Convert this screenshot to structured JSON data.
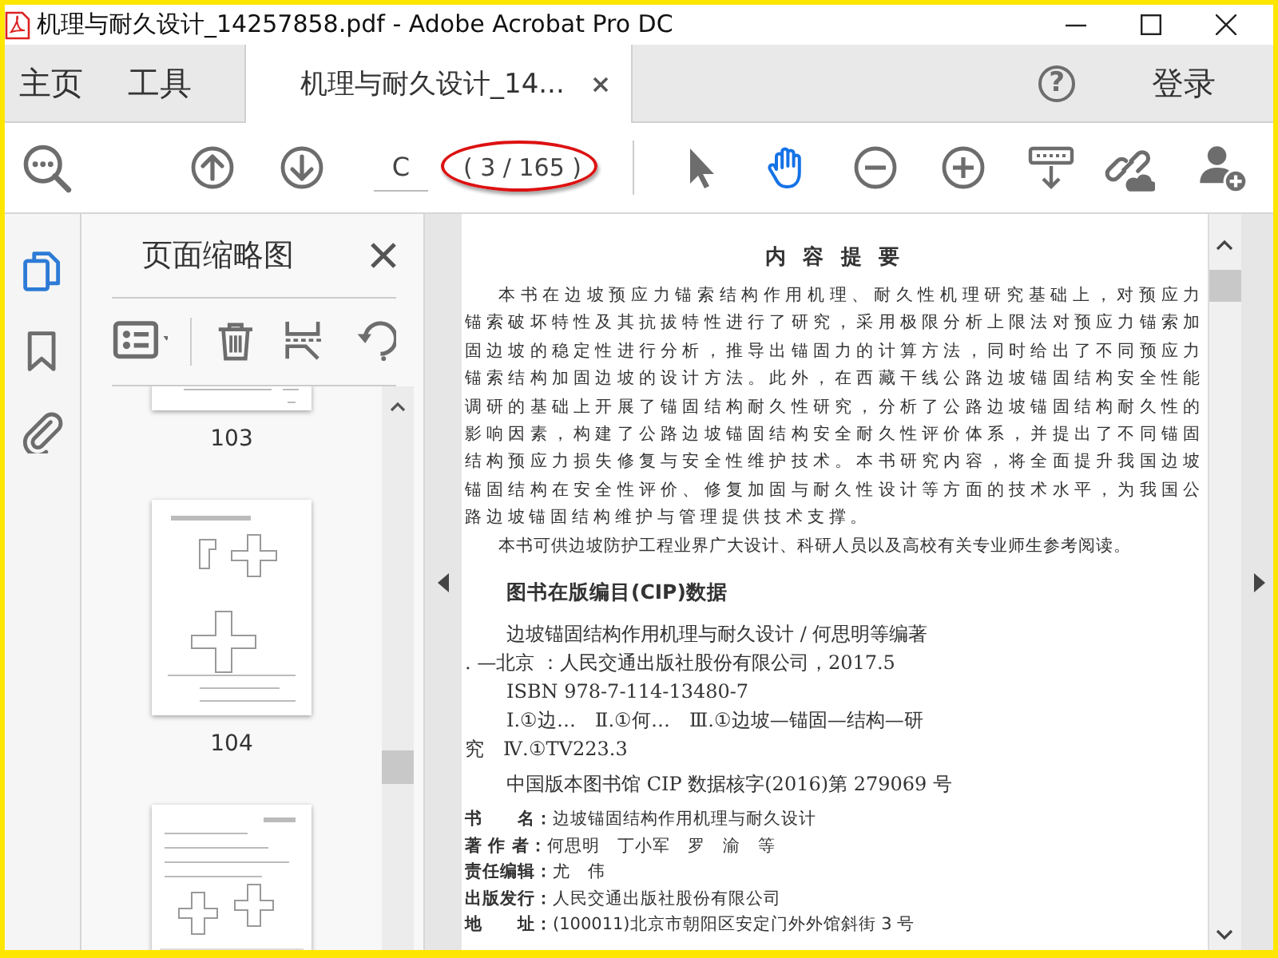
{
  "window": {
    "title": "机理与耐久设计_14257858.pdf - Adobe Acrobat Pro DC"
  },
  "tabs": [
    {
      "label": "主页",
      "selected": false,
      "closable": false
    },
    {
      "label": "工具",
      "selected": false,
      "closable": false
    },
    {
      "label": "机理与耐久设计_14...",
      "selected": true,
      "closable": true
    }
  ],
  "help": {
    "label": "?"
  },
  "sign_in": {
    "label": "登录"
  },
  "toolbar": {
    "search_tool": {
      "kind": "find"
    },
    "nav_tools": [
      {
        "kind": "previous-page"
      },
      {
        "kind": "next-page"
      }
    ],
    "page_input": {
      "value": "C"
    },
    "page_count": {
      "label": "( 3 / 165 )",
      "circled": true
    },
    "view_tools": [
      {
        "kind": "pointer",
        "selected": false
      },
      {
        "kind": "hand",
        "selected": true
      },
      {
        "kind": "zoom-out",
        "selected": false
      },
      {
        "kind": "zoom-in",
        "selected": false
      },
      {
        "kind": "scroll-mode",
        "selected": false
      }
    ],
    "share_tools": [
      {
        "kind": "link-cloud"
      },
      {
        "kind": "add-user"
      }
    ]
  },
  "sidebar": {
    "rail": [
      {
        "kind": "pages",
        "selected": true
      },
      {
        "kind": "bookmarks",
        "selected": false
      },
      {
        "kind": "attachments",
        "selected": false
      }
    ],
    "panel": {
      "title": "页面缩略图",
      "tools": [
        {
          "kind": "options"
        },
        {
          "kind": "delete"
        },
        {
          "kind": "extract"
        },
        {
          "kind": "rotate"
        }
      ],
      "thumbnails": [
        {
          "kind": "partial-top",
          "label": "103"
        },
        {
          "kind": "full",
          "label": "104"
        },
        {
          "kind": "partial-bottom"
        }
      ]
    }
  },
  "document": {
    "heading": "内 容 提 要",
    "paragraphs": [
      "本书在边坡预应力锚索结构作用机理、耐久性机理研究基础上，对预应力锚索破坏特性及其抗拔特性进行了研究，采用极限分析上限法对预应力锚索加固边坡的稳定性进行分析，推导出锚固力的计算方法，同时给出了不同预应力锚索结构加固边坡的设计方法。此外，在西藏干线公路边坡锚固结构安全性能调研的基础上开展了锚固结构耐久性研究，分析了公路边坡锚固结构耐久性的影响因素，构建了公路边坡锚固结构安全耐久性评价体系，并提出了不同锚固结构预应力损失修复与安全性维护技术。本书研究内容，将全面提升我国边坡锚固结构在安全性评价、修复加固与耐久性设计等方面的技术水平，为我国公路边坡锚固结构维护与管理提供技术支撑。",
      "本书可供边坡防护工程业界广大设计、科研人员以及高校有关专业师生参考阅读。"
    ],
    "cip_title": "图书在版编目(CIP)数据",
    "cip_lines": [
      {
        "text": "边坡锚固结构作用机理与耐久设计 / 何思明等编著",
        "indent": true
      },
      {
        "text": ". —北京 ：人民交通出版社股份有限公司，2017.5",
        "indent": false
      },
      {
        "text": "ISBN 978-7-114-13480-7",
        "indent": true
      },
      {
        "text": "Ⅰ.①边…　Ⅱ.①何…　Ⅲ.①边坡—锚固—结构—研",
        "indent": true
      },
      {
        "text": "究　Ⅳ.①TV223.3",
        "indent": false
      },
      {
        "text": "中国版本图书馆 CIP 数据核字(2016)第 279069 号",
        "indent": true
      }
    ],
    "book_info": [
      {
        "label": "书　　名：",
        "value": "边坡锚固结构作用机理与耐久设计"
      },
      {
        "label": "著 作 者：",
        "value": "何思明　丁小军　罗　渝　等"
      },
      {
        "label": "责任编辑：",
        "value": "尤　伟"
      },
      {
        "label": "出版发行：",
        "value": "人民交通出版社股份有限公司"
      },
      {
        "label": "地　　址：",
        "value": "(100011)北京市朝阳区安定门外外馆斜街 3 号"
      }
    ]
  }
}
